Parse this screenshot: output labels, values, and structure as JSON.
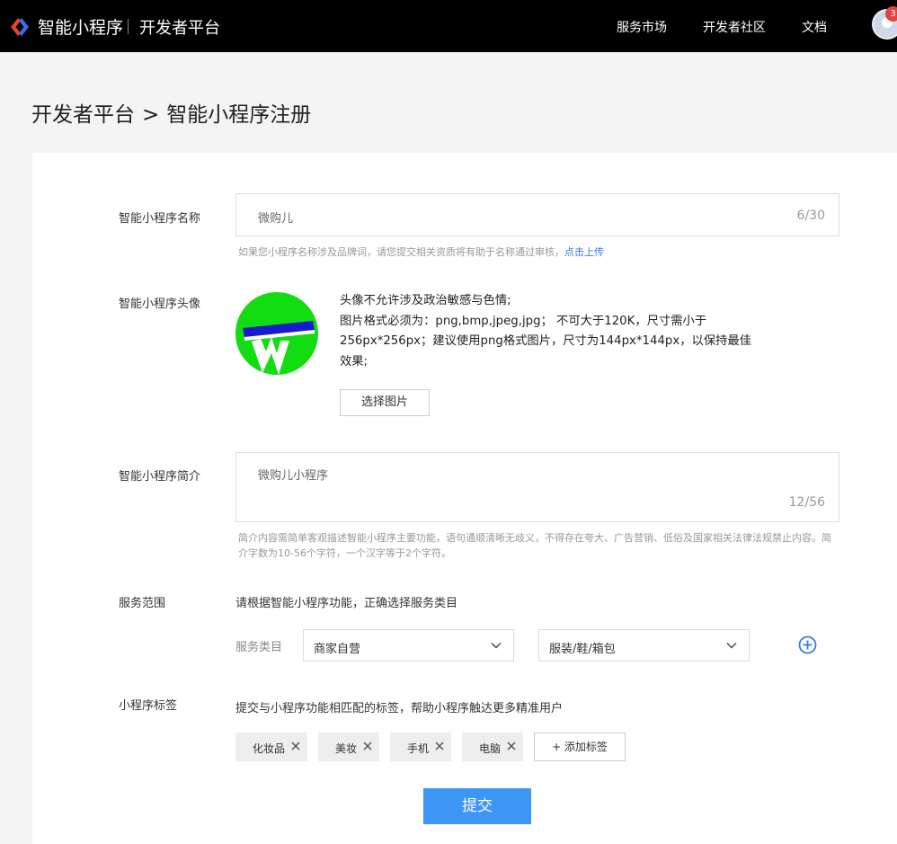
{
  "header": {
    "brand": "智能小程序",
    "platform": "开发者平台",
    "nav": [
      "服务市场",
      "开发者社区",
      "文档"
    ],
    "notification_count": "3",
    "logo_icon": "smart-miniprogram-logo-icon",
    "colors": {
      "bar": "#000000",
      "badge": "#e34242",
      "accent": "#3d96f5",
      "link": "#3a7bd5"
    }
  },
  "breadcrumb": {
    "parent": "开发者平台",
    "separator": ">",
    "current": "智能小程序注册"
  },
  "form": {
    "name": {
      "label": "智能小程序名称",
      "value": "微购儿",
      "counter": "6/30",
      "hint": "如果您小程序名称涉及品牌词，请您提交相关资质将有助于名称通过审核，",
      "hint_link": "点击上传"
    },
    "avatar": {
      "label": "智能小程序头像",
      "requirements": "头像不允许涉及政治敏感与色情;\n图片格式必须为：png,bmp,jpeg,jpg；  不可大于120K，尺寸需小于256px*256px；建议使用png格式图片，尺寸为144px*144px，以保持最佳效果;",
      "button": "选择图片"
    },
    "intro": {
      "label": "智能小程序简介",
      "value": "微购儿小程序",
      "counter": "12/56",
      "hint": "简介内容需简单客观描述智能小程序主要功能，语句通顺清晰无歧义，不得存在夸大、广告营销、低俗及国家相关法律法规禁止内容。简介字数为10-56个字符，一个汉字等于2个字符。"
    },
    "service": {
      "label": "服务范围",
      "desc": "请根据智能小程序功能，正确选择服务类目",
      "category_label": "服务类目",
      "category_1": "商家自营",
      "category_2": "服装/鞋/箱包"
    },
    "tags": {
      "label": "小程序标签",
      "desc": "提交与小程序功能相匹配的标签，帮助小程序触达更多精准用户",
      "items": [
        "化妆品",
        "美妆",
        "手机",
        "电脑"
      ],
      "add": "+ 添加标签"
    },
    "submit": "提交"
  }
}
